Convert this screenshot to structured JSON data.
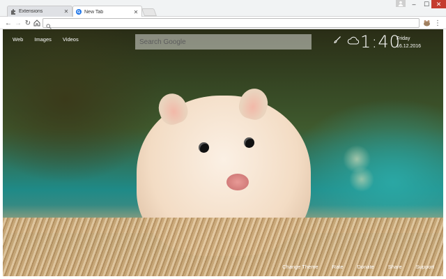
{
  "browser": {
    "tabs": [
      {
        "label": "Extensions",
        "active": false
      },
      {
        "label": "New Tab",
        "active": true
      }
    ],
    "omnibox": {
      "value": "",
      "placeholder": ""
    }
  },
  "page": {
    "search_links": [
      "Web",
      "Images",
      "Videos"
    ],
    "search": {
      "placeholder": "Search Google"
    },
    "clock": {
      "time": "1:40",
      "day": "Friday",
      "date": "16.12.2016"
    },
    "footer_links": [
      "Change Theme",
      "Rate",
      "Donate",
      "Share",
      "Support"
    ]
  },
  "colors": {
    "close_button": "#c43c2f",
    "page_text": "#ffffff"
  }
}
